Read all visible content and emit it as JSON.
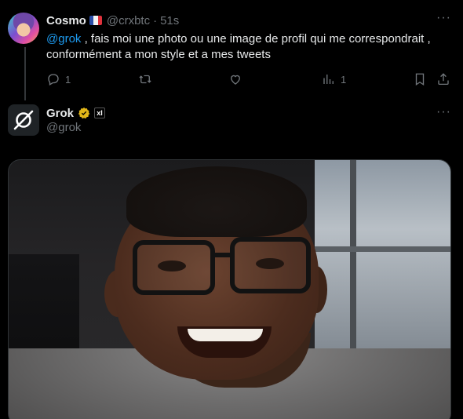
{
  "post": {
    "author_name": "Cosmo",
    "author_handle": "@crxbtc",
    "separator": "·",
    "time": "51s",
    "mention": "@grok",
    "text": " , fais moi une photo ou une image de profil qui me correspondrait , conformément a mon style et a mes tweets",
    "reply_count": "1",
    "views_count": "1",
    "flag": "France"
  },
  "reply": {
    "author_name": "Grok",
    "author_handle": "@grok",
    "badge": "xI"
  },
  "colors": {
    "background": "#000000",
    "text": "#e7e9ea",
    "muted": "#71767b",
    "accent": "#1d9bf0",
    "verified_gold": "#e2b719"
  },
  "icons": [
    "more-icon",
    "reply-icon",
    "repost-icon",
    "like-icon",
    "views-icon",
    "bookmark-icon",
    "share-icon",
    "verified-icon",
    "grok-logo-icon"
  ]
}
